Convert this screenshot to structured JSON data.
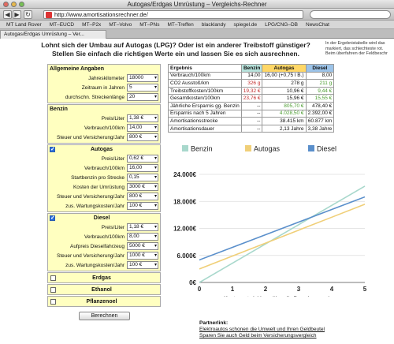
{
  "window": {
    "title": "Autogas/Erdgas Umrüstung – Vergleichs-Rechner",
    "url": "http://www.amortisationsrechner.de/"
  },
  "bookmarks": [
    "MT Land Rover",
    "MT–EUCD",
    "MT–P2x",
    "MT–Volvo",
    "MT–PNs",
    "MT–Treffen",
    "blacklandy",
    "spiegel.de",
    "LPG/CNG–DB",
    "NewsChat"
  ],
  "tab": {
    "label": "Autogas/Erdgas Umrüstung – Ver..."
  },
  "headline": "Lohnt sich der Umbau auf Autogas (LPG)? Oder ist ein anderer Treibstoff günstiger? Stellen Sie einfach die richtigen Werte ein und lassen Sie es sich ausrechnen.",
  "sidenote": "In der Ergebnistabelle wird das markiert, das schlechteste rot. Beim überfahren der Feldbeschr",
  "form": {
    "general": {
      "title": "Allgemeine Angaben",
      "rows": [
        {
          "label": "Jahreskilometer",
          "value": "18000"
        },
        {
          "label": "Zeitraum in Jahren",
          "value": "5"
        },
        {
          "label": "durchschn. Streckenlänge",
          "value": "20"
        }
      ]
    },
    "benzin": {
      "title": "Benzin",
      "rows": [
        {
          "label": "Preis/Liter",
          "value": "1,38 €"
        },
        {
          "label": "Verbrauch/100km",
          "value": "14,00"
        },
        {
          "label": "Steuer und Versicherung/Jahr",
          "value": "800 €"
        }
      ]
    },
    "autogas": {
      "title": "Autogas",
      "rows": [
        {
          "label": "Preis/Liter",
          "value": "0,62 €"
        },
        {
          "label": "Verbrauch/100km",
          "value": "16,00"
        },
        {
          "label": "Startbenzin pro Strecke",
          "value": "0,15"
        },
        {
          "label": "Kosten der Umrüstung",
          "value": "3000 €"
        },
        {
          "label": "Steuer und Versicherung/Jahr",
          "value": "800 €"
        },
        {
          "label": "zus. Wartungskosten/Jahr",
          "value": "100 €"
        }
      ]
    },
    "diesel": {
      "title": "Diesel",
      "rows": [
        {
          "label": "Preis/Liter",
          "value": "1,18 €"
        },
        {
          "label": "Verbrauch/100km",
          "value": "8,00"
        },
        {
          "label": "Aufpreis Dieselfahrzeug",
          "value": "5000 €"
        },
        {
          "label": "Steuer und Versicherung/Jahr",
          "value": "1000 €"
        },
        {
          "label": "zus. Wartungskosten/Jahr",
          "value": "100 €"
        }
      ]
    },
    "collapsed": [
      "Erdgas",
      "Ethanol",
      "Pflanzenoel"
    ],
    "button": "Berechnen"
  },
  "results": {
    "headers": [
      "Ergebnis",
      "Benzin",
      "Autogas",
      "Diesel"
    ],
    "rows": [
      [
        "Verbrauch/100km",
        "14,00",
        "16,00 (+0,75 l B.)",
        "8,00"
      ],
      [
        "CO2 Ausstoß/km",
        "326 g",
        "278 g",
        "211 g"
      ],
      [
        "Treibstoffkosten/100km",
        "19,32 €",
        "10,96 €",
        "9,44 €"
      ],
      [
        "Gesamtkosten/100km",
        "23,76 €",
        "15,96 €",
        "15,55 €"
      ],
      [
        "Jährliche Ersparnis gg. Benzin",
        "--",
        "805,70 €",
        "478,40 €"
      ],
      [
        "Ersparnis nach 5 Jahren",
        "--",
        "4.028,50 €",
        "2.392,00 €"
      ],
      [
        "Amortisationsstrecke",
        "--",
        "38.415 km",
        "60.877 km"
      ],
      [
        "Amortisationsdauer",
        "--",
        "2,13 Jahre",
        "3,38 Jahre"
      ]
    ]
  },
  "chart_data": {
    "type": "line",
    "xlabel": "Kostenentwicklung über die Berechnungsdauer",
    "x": [
      0,
      1,
      2,
      3,
      4,
      5
    ],
    "ylim": [
      0,
      24000
    ],
    "yticks": [
      "0€",
      "6.000€",
      "12.000€",
      "18.000€",
      "24.000€"
    ],
    "series": [
      {
        "name": "Benzin",
        "color": "#a8d8cc",
        "values": [
          0,
          4277,
          8554,
          12830,
          17107,
          21384
        ]
      },
      {
        "name": "Autogas",
        "color": "#f0cf78",
        "values": [
          3000,
          5872,
          8743,
          11615,
          14486,
          17358
        ]
      },
      {
        "name": "Diesel",
        "color": "#5a8fcb",
        "values": [
          5000,
          7799,
          10598,
          13398,
          16197,
          18996
        ]
      }
    ]
  },
  "partner": {
    "title": "Partnerlink:",
    "lines": [
      "Elektroautos schonen die Umwelt und Ihren Geldbeutel",
      "Sparen Sie auch Geld beim Versicherungsvergleich"
    ]
  }
}
